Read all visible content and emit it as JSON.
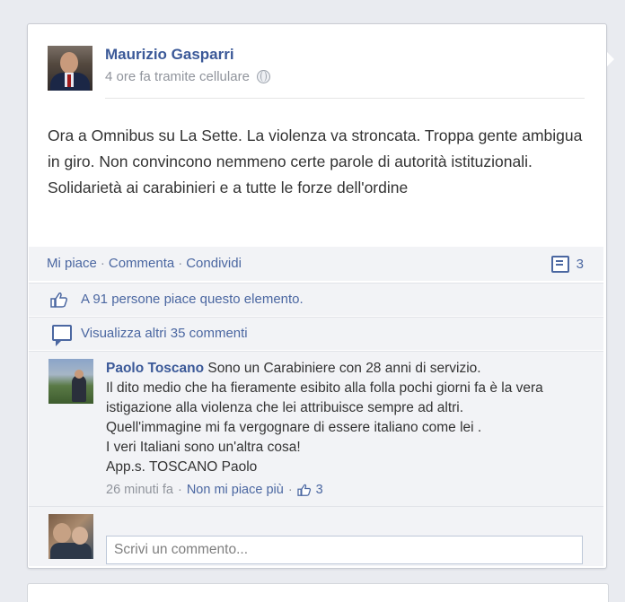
{
  "post": {
    "author": "Maurizio Gasparri",
    "meta": "4 ore fa tramite cellulare",
    "text": "Ora a Omnibus su La Sette. La violenza va stroncata. Troppa gente ambigua in giro. Non convincono nemmeno certe parole di autorità istituzionali. Solidarietà ai carabinieri e a tutte le forze dell'ordine"
  },
  "actions": {
    "like": "Mi piace",
    "comment": "Commenta",
    "share": "Condividi",
    "comment_count": "3"
  },
  "likes_text": "A 91 persone piace questo elemento.",
  "view_more": "Visualizza altri 35 commenti",
  "comment": {
    "author": "Paolo Toscano",
    "text": "Sono un Carabiniere con 28 anni di servizio.\nIl dito medio che ha fieramente esibito alla folla pochi giorni fa è la vera istigazione alla violenza che lei attribuisce sempre ad altri.\nQuell'immagine mi fa vergognare di essere italiano come lei .\nI veri Italiani sono un'altra cosa!\nApp.s. TOSCANO Paolo",
    "time": "26 minuti fa",
    "unlike": "Non mi piace più",
    "like_count": "3"
  },
  "write_comment": {
    "placeholder": "Scrivi un commento..."
  },
  "colors": {
    "link_blue": "#3b5998",
    "panel_bg": "#f2f3f6",
    "page_bg": "#e9ebf0"
  }
}
